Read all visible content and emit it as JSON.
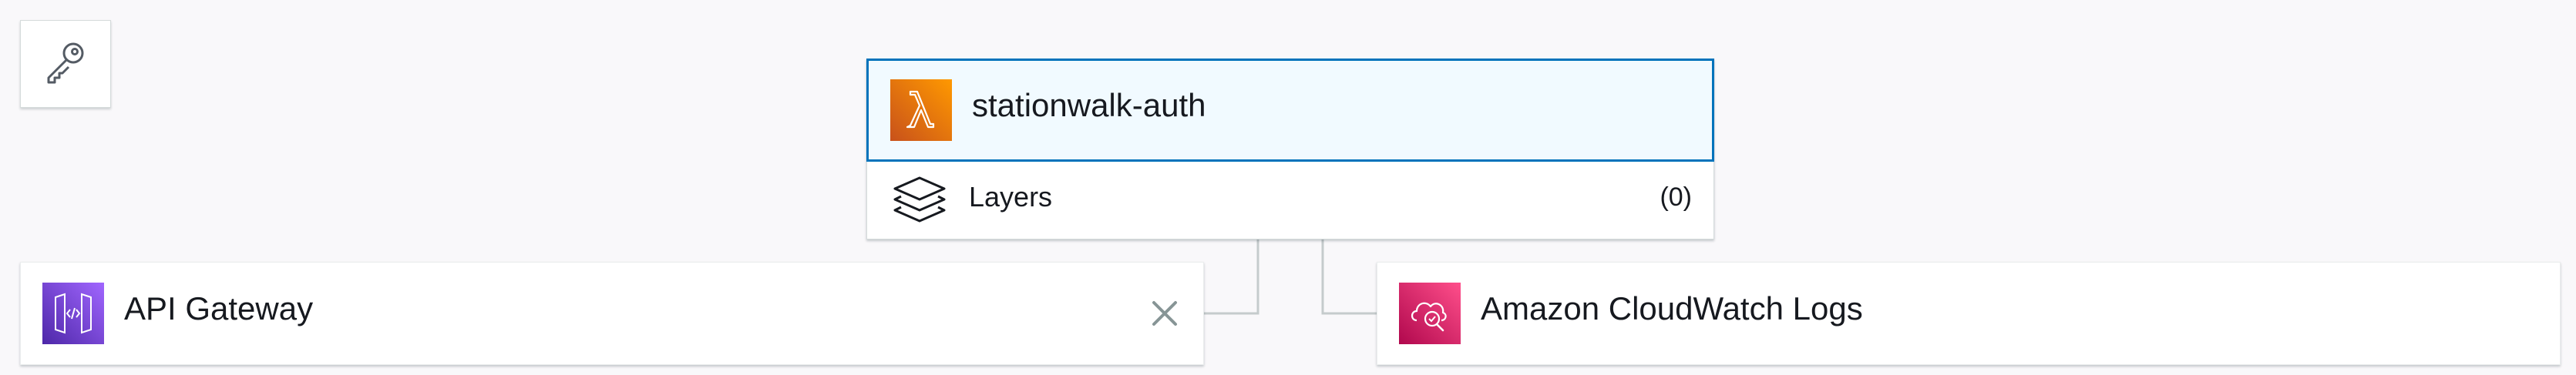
{
  "permissions": {
    "icon": "key-icon"
  },
  "function": {
    "name": "stationwalk-auth",
    "icon": "lambda-icon",
    "accent_color": "#0073bb",
    "layers": {
      "label": "Layers",
      "count": "(0)",
      "icon": "layers-icon"
    }
  },
  "triggers": [
    {
      "label": "API Gateway",
      "icon": "api-gateway-icon",
      "remove_icon": "close-icon"
    }
  ],
  "destinations": [
    {
      "label": "Amazon CloudWatch Logs",
      "icon": "cloudwatch-logs-icon"
    }
  ]
}
